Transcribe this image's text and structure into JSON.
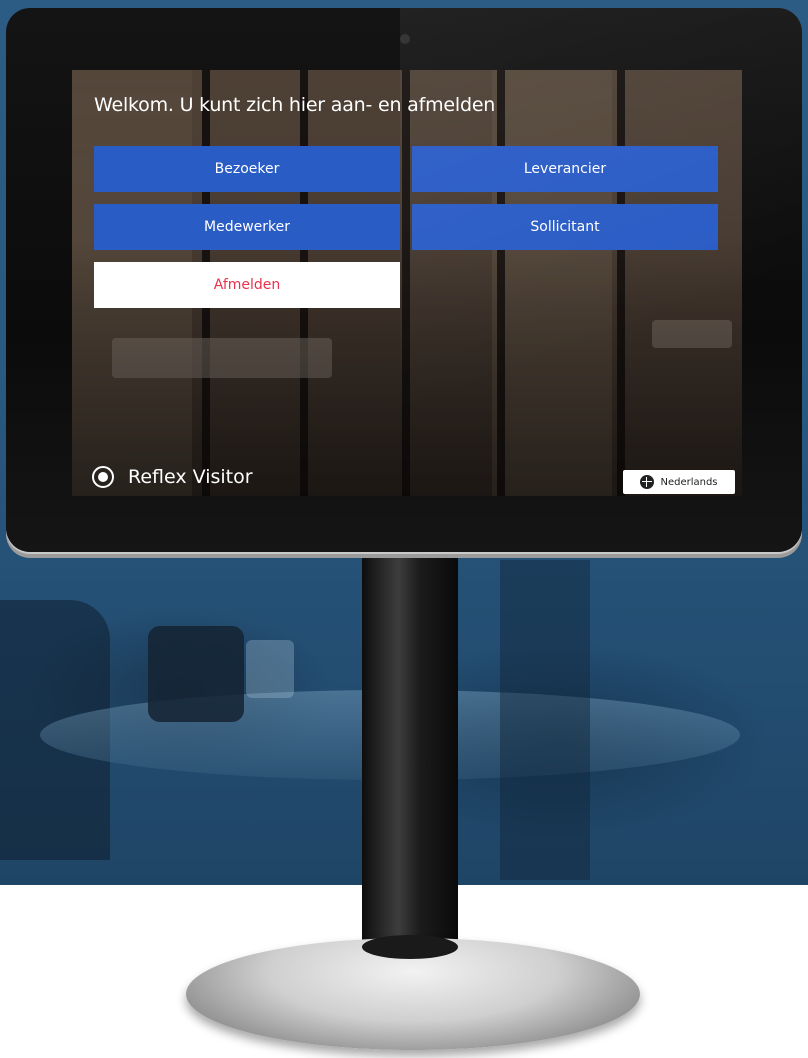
{
  "screen": {
    "welcome_text": "Welkom. U kunt zich hier aan- en afmelden",
    "buttons": {
      "visitor": "Bezoeker",
      "supplier": "Leverancier",
      "employee": "Medewerker",
      "applicant": "Sollicitant",
      "sign_out": "Afmelden"
    },
    "brand": "Reflex Visitor",
    "language": "Nederlands"
  },
  "colors": {
    "button_blue": "#2a5cc6",
    "sign_out_text": "#e8324a",
    "background_blue": "#2a5a82"
  },
  "icons": {
    "brand": "reflex-logo-icon",
    "language": "globe-icon"
  }
}
